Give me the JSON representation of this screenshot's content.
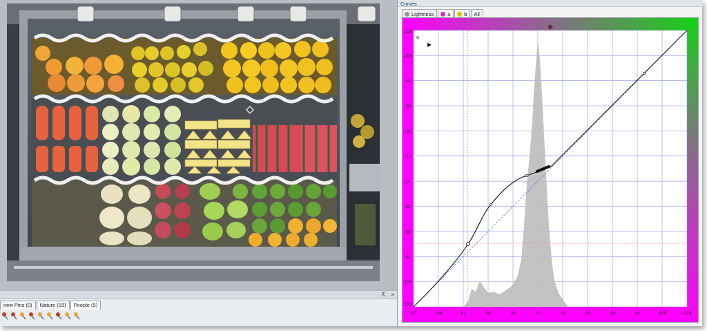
{
  "viewer": {
    "pins_bar": {
      "tabs": [
        "new Pins (0)",
        "Nature (15)",
        "People (9)"
      ],
      "active_tab": 2,
      "controls": [
        "⊼",
        "×"
      ],
      "pin_icons": [
        "pin-icon",
        "pin-icon",
        "pin-icon",
        "pin-icon",
        "pin-icon",
        "pin-icon",
        "pin-icon",
        "pin-icon",
        "pin-icon"
      ]
    }
  },
  "curves": {
    "title": "Curves",
    "tabs": [
      {
        "label": "Lightness",
        "color": "#9a9a9a"
      },
      {
        "label": "a",
        "color": "#d12bd1"
      },
      {
        "label": "b",
        "color": "#d6c400"
      },
      {
        "label": "All",
        "color": ""
      }
    ],
    "active_tab": 1,
    "channel_label": "a",
    "y_ticks": [
      "-128",
      "-105",
      "-81",
      "-58",
      "-35",
      "-12",
      "12",
      "35",
      "58",
      "81",
      "104",
      "127"
    ],
    "x_ticks": [
      "127",
      "104",
      "81",
      "58",
      "35",
      "12",
      "-12",
      "-35",
      "-58",
      "-81",
      "-105",
      "-128"
    ],
    "colors": {
      "magenta": "#ff00ff",
      "green": "#14d214",
      "grid": "#8c96e6",
      "histogram": "#bdbdbd"
    }
  }
}
